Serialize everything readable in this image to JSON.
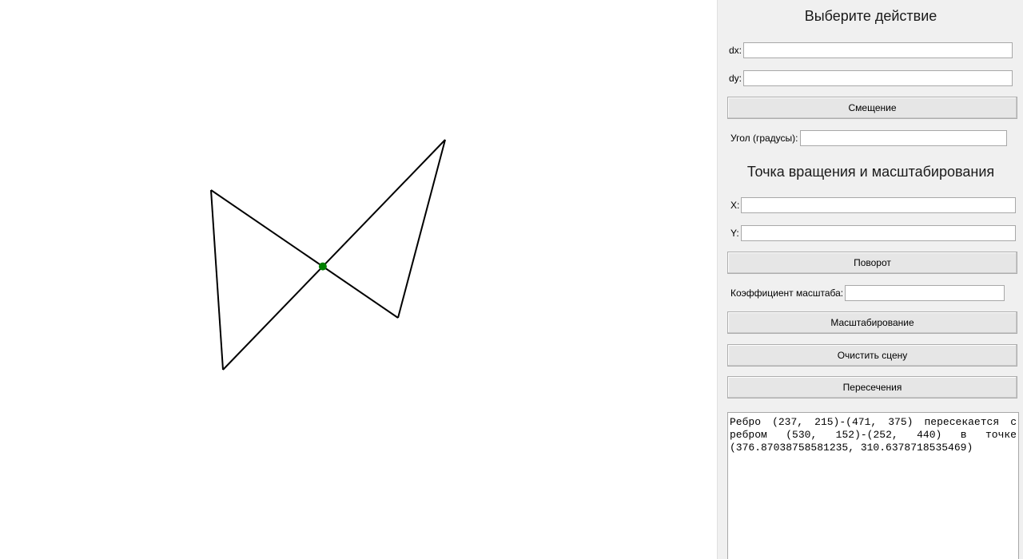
{
  "panel": {
    "title": "Выберите действие",
    "dx_label": "dx:",
    "dx_value": "",
    "dy_label": "dy:",
    "dy_value": "",
    "move_button": "Смещение",
    "angle_label": "Угол (градусы):",
    "angle_value": "",
    "pivot_title": "Точка вращения и масштабирования",
    "x_label": "X:",
    "x_value": "",
    "y_label": "Y:",
    "y_value": "",
    "rotate_button": "Поворот",
    "scale_label": "Коэффициент масштаба:",
    "scale_value": "",
    "scale_button": "Масштабирование",
    "clear_button": "Очистить сцену",
    "intersect_button": "Пересечения",
    "output_text": "Ребро (237, 215)-(471, 375) пересекается с ребром (530, 152)-(252, 440) в точке (376.87038758581235, 310.6378718535469)"
  },
  "scene": {
    "edges": [
      {
        "from": [
          237,
          215
        ],
        "to": [
          471,
          375
        ]
      },
      {
        "from": [
          471,
          375
        ],
        "to": [
          530,
          152
        ]
      },
      {
        "from": [
          530,
          152
        ],
        "to": [
          252,
          440
        ]
      },
      {
        "from": [
          252,
          440
        ],
        "to": [
          237,
          215
        ]
      }
    ],
    "intersection": [
      376.87038758581235,
      310.6378718535469
    ],
    "line_color": "#000000",
    "point_color": "#008000"
  }
}
